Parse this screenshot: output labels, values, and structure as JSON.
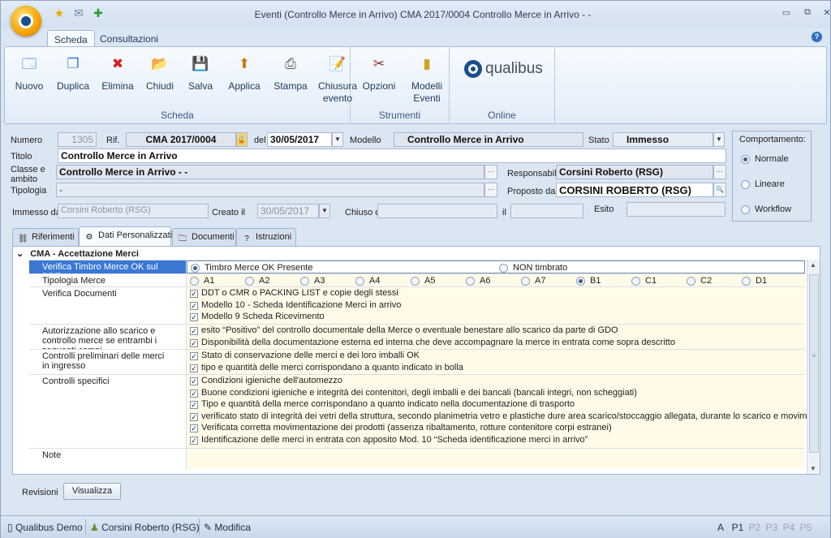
{
  "window": {
    "title": "Eventi (Controllo Merce in Arrivo)  CMA 2017/0004 Controllo Merce in Arrivo - -",
    "min": "▭",
    "restore": "⧉",
    "close": "✕"
  },
  "quick_access": [
    {
      "icon": "star-icon",
      "glyph": "★"
    },
    {
      "icon": "mail-icon",
      "glyph": "✉"
    },
    {
      "icon": "plus-icon",
      "glyph": "✚"
    }
  ],
  "ribbon_tabs": [
    "Scheda",
    "Consultazioni"
  ],
  "ribbon": {
    "groups": [
      {
        "label": "Scheda",
        "buttons": [
          {
            "label": "Nuovo",
            "icon": "new-icon",
            "glyph": "🗔"
          },
          {
            "label": "Duplica",
            "icon": "duplicate-icon",
            "glyph": "❐"
          },
          {
            "label": "Elimina",
            "icon": "delete-icon",
            "glyph": "✖"
          },
          {
            "label": "Chiudi",
            "icon": "close-folder-icon",
            "glyph": "📂"
          },
          {
            "label": "Salva",
            "icon": "save-icon",
            "glyph": "💾"
          },
          {
            "label": "Applica",
            "icon": "apply-icon",
            "glyph": "⬆"
          },
          {
            "label": "Stampa",
            "icon": "print-icon",
            "glyph": "⎙"
          },
          {
            "label": "Chiusura evento",
            "icon": "close-event-icon",
            "glyph": "📝"
          }
        ]
      },
      {
        "label": "Strumenti",
        "buttons": [
          {
            "label": "Opzioni",
            "icon": "tools-icon",
            "glyph": "✂"
          },
          {
            "label": "Modelli Eventi",
            "icon": "models-icon",
            "glyph": "▮"
          }
        ]
      },
      {
        "label": "Online",
        "brand": "qualibus"
      }
    ]
  },
  "form": {
    "numero_label": "Numero",
    "numero": "1305",
    "rif_label": "Rif.",
    "rif": "CMA 2017/0004",
    "del_label": "del",
    "del": "30/05/2017",
    "modello_label": "Modello",
    "modello": "Controllo Merce in Arrivo",
    "stato_label": "Stato",
    "stato": "Immesso",
    "titolo_label": "Titolo",
    "titolo": "Controllo Merce in Arrivo",
    "classe_label": "Classe e ambito",
    "classe": "Controllo Merce in Arrivo - -",
    "responsabile_label": "Responsabile",
    "responsabile": "Corsini Roberto (RSG)",
    "tipologia_label": "Tipologia",
    "tipologia": "-",
    "proposto_label": "Proposto da",
    "proposto": "CORSINI ROBERTO (RSG)",
    "immesso_label": "Immesso da",
    "immesso": "Corsini Roberto (RSG)",
    "creato_label": "Creato il",
    "creato": "30/05/2017",
    "chiuso_label": "Chiuso da",
    "chiuso": "",
    "il_label": "il",
    "il": "",
    "esito_label": "Esito",
    "esito": "",
    "ellipsis": "···"
  },
  "comportamento": {
    "title": "Comportamento:",
    "options": [
      "Normale",
      "Lineare",
      "Workflow"
    ],
    "selected": "Normale"
  },
  "form_tabs": [
    {
      "label": "Riferimenti",
      "icon": "links-icon",
      "glyph": "⛓"
    },
    {
      "label": "Dati Personalizzati",
      "icon": "custom-data-icon",
      "glyph": "⚙"
    },
    {
      "label": "Documenti",
      "icon": "documents-icon",
      "glyph": "🗀"
    },
    {
      "label": "Istruzioni",
      "icon": "help-icon",
      "glyph": "?"
    }
  ],
  "grid": {
    "section": "CMA - Accettazione Merci",
    "rows": [
      {
        "caption": "Verifica Timbro Merce OK sul DDT",
        "radios": [
          "Timbro Merce OK Presente",
          "NON timbrato"
        ],
        "selected": 0
      },
      {
        "caption": "Tipologia Merce",
        "radios": [
          "A1",
          "A2",
          "A3",
          "A4",
          "A5",
          "A6",
          "A7",
          "B1",
          "C1",
          "C2",
          "D1"
        ],
        "selected": 7
      },
      {
        "caption": "Verifica Documenti",
        "checks": [
          "DDT o CMR o PACKING LIST e copie degli stessi",
          "Modello 10 - Scheda Identificazione Merci in arrivo",
          "Modello 9 Scheda Ricevimento"
        ]
      },
      {
        "caption": "Autorizzazione allo scarico e controllo merce se entrambi i seguenti campi",
        "checks": [
          "esito “Positivo” del controllo documentale della Merce o eventuale benestare allo scarico da parte di GDO",
          "Disponibilità della documentazione esterna ed interna che deve accompagnare la merce in entrata come sopra descritto"
        ]
      },
      {
        "caption": "Controlli preliminari delle merci in ingresso",
        "checks": [
          "Stato di conservazione delle merci e dei loro imballi OK",
          "tipo e quantità delle merci corrispondano a quanto indicato in bolla"
        ]
      },
      {
        "caption": "Controlli specifici",
        "checks": [
          "Condizioni igieniche dell'automezzo",
          "Buone condizioni igieniche e integrità dei contenitori, degli imballi e dei bancali (bancali integri, non scheggiati)",
          "Tipo e quantità della merce corrispondano a quanto indicato nella documentazione di trasporto",
          "verificato stato di integrità dei vetri della struttura, secondo planimetria vetro e plastiche dure area scarico/stoccaggio allegata, durante lo scarico e movimentazione",
          "Verificata corretta movimentazione dei prodotti (assenza ribaltamento, rotture contenitore corpi estranei)",
          "Identificazione delle merci in entrata con apposito Mod. 10 “Scheda identificazione merci in arrivo”"
        ]
      },
      {
        "caption": "Note",
        "value": ""
      }
    ]
  },
  "revisioni_label": "Revisioni",
  "visualizza_label": "Visualizza",
  "statusbar": {
    "company": "Qualibus Demo",
    "user": "Corsini Roberto (RSG)",
    "mode": "Modifica",
    "pages": [
      "A",
      "P1",
      "P2",
      "P3",
      "P4",
      "P5"
    ],
    "active_pages": [
      "A",
      "P1"
    ]
  }
}
